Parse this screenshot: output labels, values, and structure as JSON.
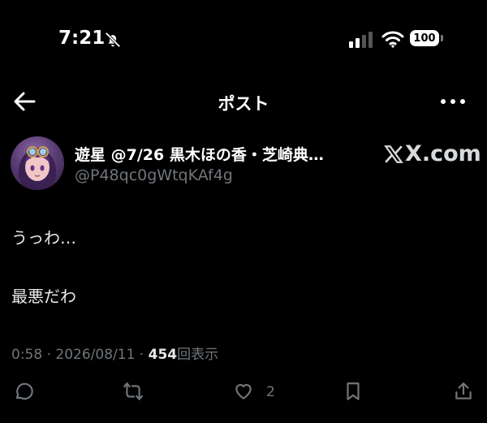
{
  "status_bar": {
    "time": "7:21",
    "battery": "100"
  },
  "nav": {
    "title": "ポスト"
  },
  "post": {
    "author_name": "遊星 @7/26 黒木ほの香・芝崎典…",
    "author_handle": "@P48qc0gWtqKAf4g",
    "watermark": "X.com",
    "text_lines": [
      "うっわ…",
      "最悪だわ"
    ],
    "time": "0:58",
    "separator": "·",
    "date": "2026/08/11",
    "views_count": "454",
    "views_label": "回表示",
    "like_count": "2"
  },
  "icons": {
    "status": [
      "bell-slash-icon",
      "cellular-signal-icon",
      "wifi-icon",
      "battery-icon"
    ],
    "nav": [
      "back-arrow-icon",
      "more-icon"
    ],
    "actions": [
      "reply-icon",
      "repost-icon",
      "like-icon",
      "bookmark-icon",
      "share-icon"
    ]
  }
}
